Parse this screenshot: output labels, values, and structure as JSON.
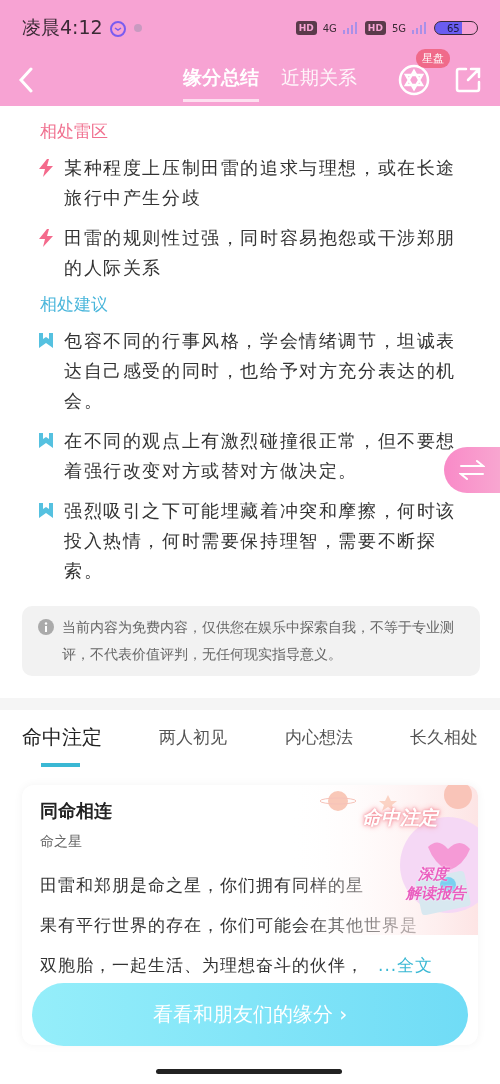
{
  "status_bar": {
    "time": "凌晨4:12",
    "hd_1": "HD",
    "hd_2": "HD",
    "signal_1": "4G",
    "signal_2": "5G",
    "battery": "65"
  },
  "nav": {
    "tabs": [
      {
        "label": "缘分总结",
        "selected": true
      },
      {
        "label": "近期关系",
        "selected": false
      }
    ],
    "badge": "星盘"
  },
  "sections": [
    {
      "title": "相处雷区",
      "kind": "warning",
      "items": [
        "某种程度上压制田雷的追求与理想，或在长途旅行中产生分歧",
        "田雷的规则性过强，同时容易抱怨或干涉郑朋的人际关系"
      ]
    },
    {
      "title": "相处建议",
      "kind": "advice",
      "items": [
        "包容不同的行事风格，学会情绪调节，坦诚表达自己感受的同时，也给予对方充分表达的机会。",
        "在不同的观点上有激烈碰撞很正常，但不要想着强行改变对方或替对方做决定。",
        "强烈吸引之下可能埋藏着冲突和摩擦，何时该投入热情，何时需要保持理智，需要不断探索。"
      ]
    }
  ],
  "disclaimer": "当前内容为免费内容，仅供您在娱乐中探索自我，不等于专业测评，不代表价值评判，无任何现实指导意义。",
  "tabs": [
    {
      "label": "命中注定",
      "selected": true
    },
    {
      "label": "两人初见",
      "selected": false
    },
    {
      "label": "内心想法",
      "selected": false
    },
    {
      "label": "长久相处",
      "selected": false
    }
  ],
  "card": {
    "title": "同命相连",
    "subtitle": "命之星",
    "banner_title": "命中注定",
    "badge_line_1": "深度",
    "badge_line_2": "解读报告",
    "lines": [
      "田雷和郑朋是命之星，你们拥有同样的星",
      "果有平行世界的存在，你们可能会在其他世界是",
      "双胞胎，一起生活、为理想奋斗的伙伴，"
    ],
    "more_link": "...全文"
  },
  "cta_button": "看看和朋友们的缘分 ›"
}
